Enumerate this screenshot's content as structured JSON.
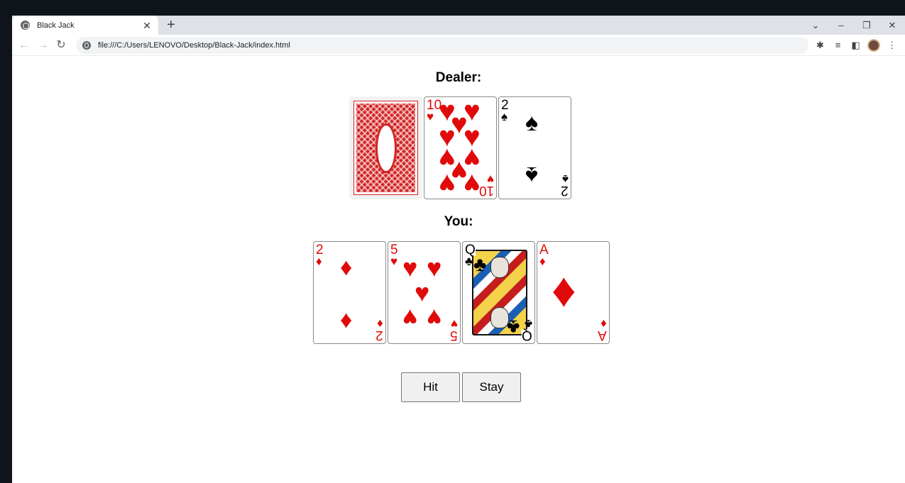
{
  "browser": {
    "tab_title": "Black Jack",
    "url": "file:///C:/Users/LENOVO/Desktop/Black-Jack/index.html"
  },
  "page": {
    "dealer_heading": "Dealer:",
    "you_heading": "You:"
  },
  "dealer": {
    "cards": [
      {
        "face": "down"
      },
      {
        "rank": "10",
        "suit": "♥",
        "color": "#e10a0a"
      },
      {
        "rank": "2",
        "suit": "♠",
        "color": "#000000"
      }
    ]
  },
  "you": {
    "cards": [
      {
        "rank": "2",
        "suit": "♦",
        "color": "#e10a0a"
      },
      {
        "rank": "5",
        "suit": "♥",
        "color": "#e10a0a"
      },
      {
        "rank": "Q",
        "suit": "♣",
        "color": "#000000"
      },
      {
        "rank": "A",
        "suit": "♦",
        "color": "#e10a0a"
      }
    ]
  },
  "controls": {
    "hit_label": "Hit",
    "stay_label": "Stay"
  }
}
